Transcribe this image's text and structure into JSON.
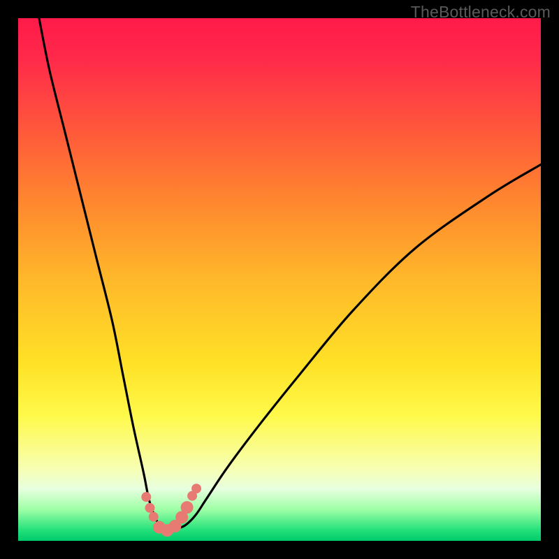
{
  "watermark": "TheBottleneck.com",
  "chart_data": {
    "type": "line",
    "title": "",
    "xlabel": "",
    "ylabel": "",
    "xlim": [
      0,
      100
    ],
    "ylim": [
      0,
      100
    ],
    "series": [
      {
        "name": "bottleneck-curve",
        "x": [
          4,
          6,
          9,
          12,
          15,
          18,
          20,
          22,
          24,
          25,
          26,
          27,
          28,
          29,
          30,
          32,
          34,
          36,
          40,
          46,
          54,
          64,
          76,
          90,
          100
        ],
        "values": [
          100,
          90,
          78,
          66,
          54,
          42,
          32,
          22,
          13,
          8,
          5,
          3,
          2.2,
          2,
          2.2,
          3,
          5,
          8,
          14,
          22,
          32,
          44,
          56,
          66,
          72
        ]
      }
    ],
    "markers": {
      "name": "highlight-dots",
      "x": [
        24.5,
        25.2,
        25.9,
        27.0,
        28.5,
        30.0,
        31.3,
        32.3,
        33.3,
        34.1
      ],
      "values": [
        8.4,
        6.3,
        4.6,
        2.6,
        2.0,
        2.8,
        4.5,
        6.4,
        8.6,
        10.0
      ],
      "radius": [
        7,
        7,
        7,
        9,
        9,
        9,
        9,
        9,
        7,
        7
      ]
    },
    "gradient_stops": [
      {
        "pos": 0,
        "color": "#ff1a4a"
      },
      {
        "pos": 50,
        "color": "#ffb82a"
      },
      {
        "pos": 76,
        "color": "#fff94a"
      },
      {
        "pos": 100,
        "color": "#00c96a"
      }
    ]
  }
}
